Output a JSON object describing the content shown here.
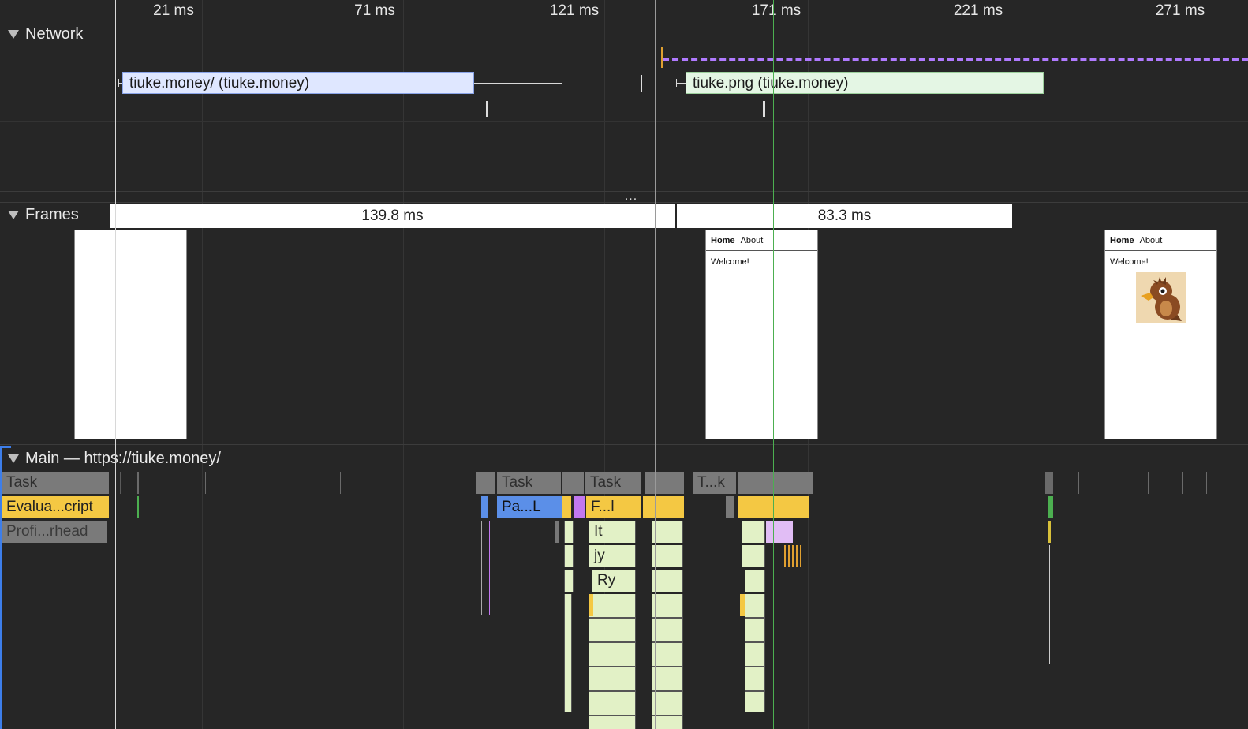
{
  "ruler": {
    "ticks": [
      "21 ms",
      "71 ms",
      "121 ms",
      "171 ms",
      "221 ms",
      "271 ms"
    ]
  },
  "network": {
    "title": "Network",
    "requests": [
      {
        "label": "tiuke.money/ (tiuke.money)",
        "color": "#dfe7ff"
      },
      {
        "label": "tiuke.png (tiuke.money)",
        "color": "#e4f6e4"
      }
    ]
  },
  "frames": {
    "title": "Frames",
    "durations": [
      "139.8 ms",
      "83.3 ms"
    ],
    "thumb_nav": {
      "home": "Home",
      "about": "About"
    },
    "thumb_text": "Welcome!"
  },
  "main": {
    "title": "Main — https://tiuke.money/",
    "labels": {
      "task": "Task",
      "eval": "Evalua...cript",
      "prof": "Profi...rhead",
      "task2": "Task",
      "task3": "Task",
      "task4": "T...k",
      "pal": "Pa...L",
      "fl": "F...l",
      "it": "It",
      "jy": "jy",
      "ry": "Ry"
    }
  },
  "toolbar": {
    "resize_handle": "..."
  },
  "colors": {
    "background": "#262626",
    "task": "#7a7a7a",
    "scripting": "#f4c843",
    "function": "#e2f1c6",
    "rendering": "#5b8fe8",
    "dashed_request": "#b07aff"
  }
}
